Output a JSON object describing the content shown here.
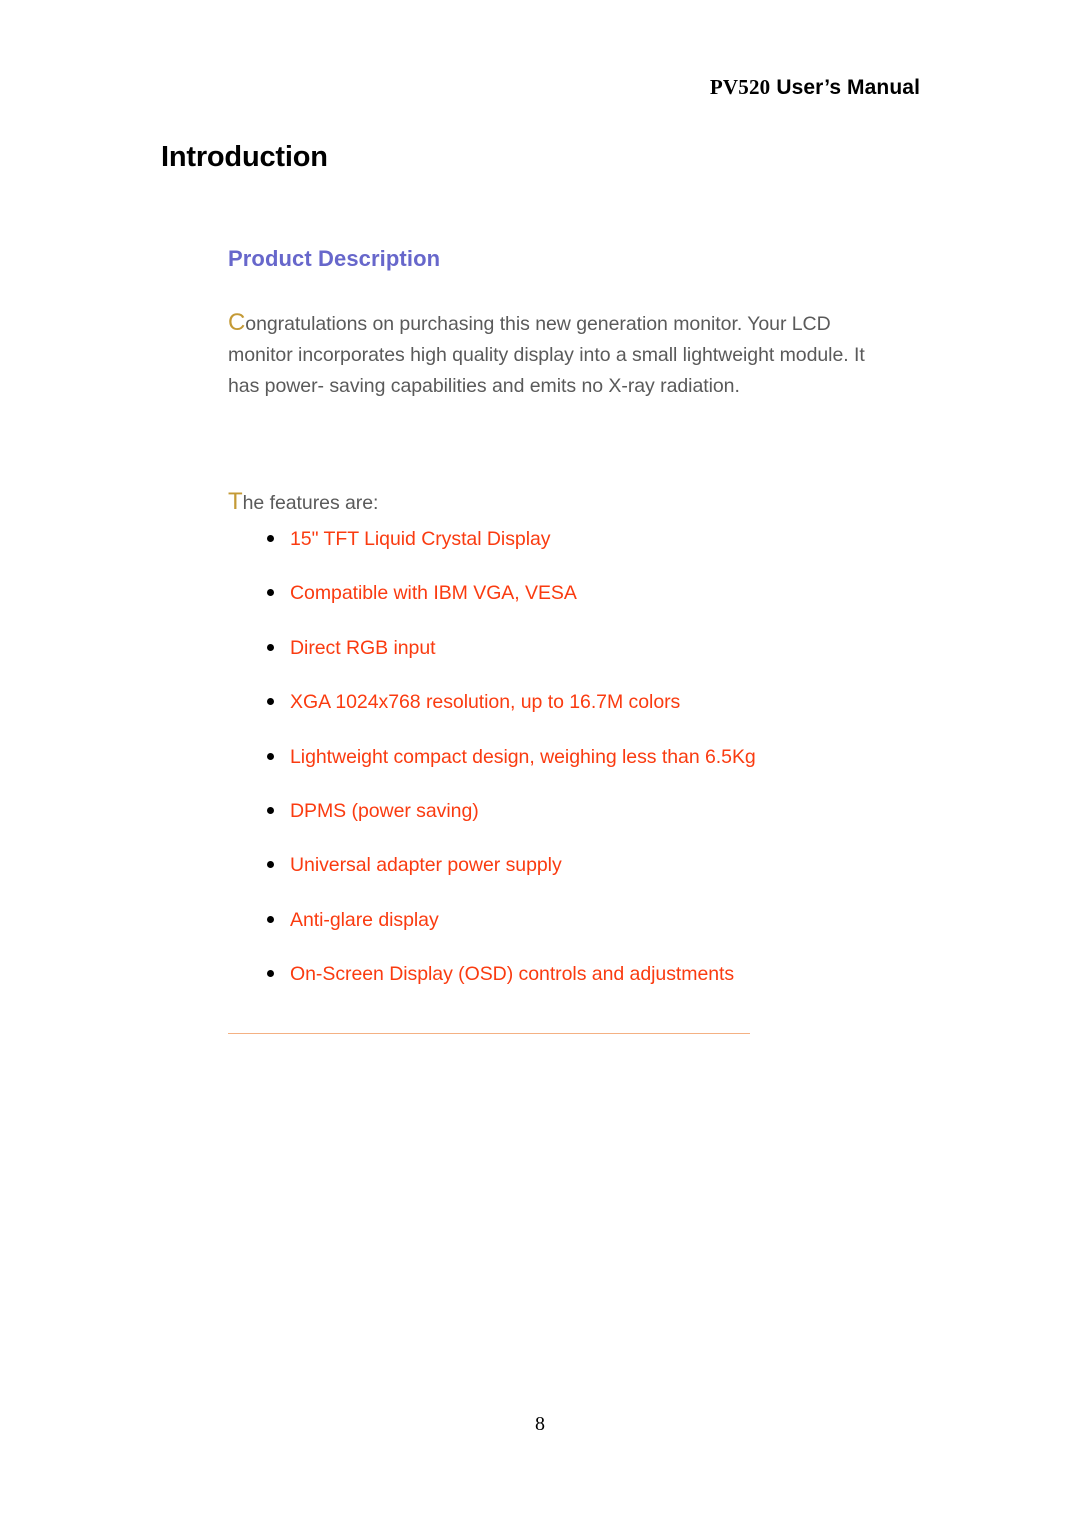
{
  "header": {
    "doc_code": "PV520",
    "doc_title": "User’s Manual"
  },
  "chapter": {
    "title": "Introduction"
  },
  "section": {
    "heading": "Product Description",
    "heading_color": "#6767CB"
  },
  "paragraph": {
    "dropcap": "C",
    "dropcap_color": "#c49a36",
    "rest": "ongratulations on purchasing this new generation monitor. Your LCD monitor incorporates high quality display into a small lightweight module. It has power- saving capabilities and emits no X-ray radiation.",
    "text_color": "#5a5a5a"
  },
  "features_lead": {
    "dropcap": "T",
    "rest": "he features are:"
  },
  "features": {
    "bullet_text_color": "#FA3B10",
    "items": [
      {
        "label": "15\" TFT Liquid Crystal Display"
      },
      {
        "label": "Compatible with IBM VGA, VESA"
      },
      {
        "label": "Direct RGB input"
      },
      {
        "label": "XGA 1024x768 resolution, up to 16.7M colors"
      },
      {
        "label": "Lightweight compact design, weighing less than 6.5Kg"
      },
      {
        "label": "DPMS (power saving)"
      },
      {
        "label": "Universal adapter power supply"
      },
      {
        "label": "Anti-glare display"
      },
      {
        "label": "On-Screen Display (OSD) controls and adjustments"
      }
    ]
  },
  "divider": {
    "color": "#F4B183"
  },
  "footer": {
    "page_number": "8"
  }
}
